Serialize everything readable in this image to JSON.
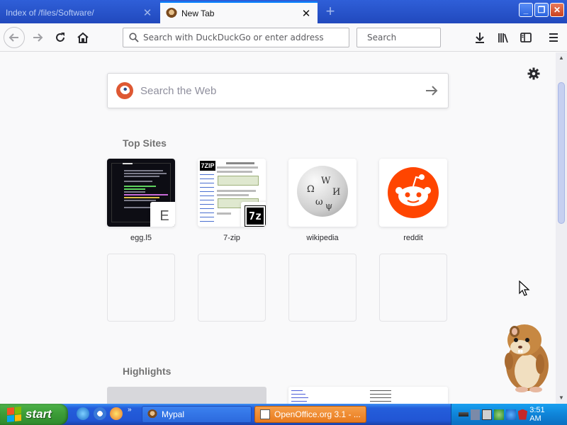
{
  "tabs": [
    {
      "title": "Index of /files/Software/",
      "active": false
    },
    {
      "title": "New Tab",
      "active": true
    }
  ],
  "window_buttons": {
    "minimize": "_",
    "maximize": "❐",
    "close": "✕"
  },
  "navbar": {
    "url_placeholder": "Search with DuckDuckGo or enter address",
    "search_placeholder": "Search"
  },
  "newtab": {
    "search_placeholder": "Search the Web",
    "top_sites_title": "Top Sites",
    "highlights_title": "Highlights",
    "top_sites": [
      {
        "label": "egg.l5",
        "badge": "E"
      },
      {
        "label": "7-zip",
        "badge": "7z"
      },
      {
        "label": "wikipedia",
        "badge": ""
      },
      {
        "label": "reddit",
        "badge": ""
      }
    ],
    "zip_logo": "7ZIP"
  },
  "taskbar": {
    "start_label": "start",
    "quicklaunch_more": "»",
    "items": [
      {
        "label": "Mypal",
        "active": false
      },
      {
        "label": "OpenOffice.org 3.1 - ...",
        "active": true
      }
    ],
    "clock": "3:51 AM"
  },
  "colors": {
    "accent": "#0a84ff",
    "reddit": "#ff4500",
    "duckduckgo": "#de5833",
    "xp_start_green": "#3b9b36",
    "xp_taskbar_blue": "#245edb",
    "openoffice_task": "#f08a24"
  },
  "icons": {
    "back": "back-arrow-icon",
    "forward": "forward-arrow-icon",
    "reload": "reload-icon",
    "home": "home-icon",
    "search": "search-icon",
    "downloads": "download-icon",
    "library": "library-icon",
    "sidebar": "sidebar-icon",
    "menu": "hamburger-menu-icon",
    "settings": "gear-icon"
  }
}
